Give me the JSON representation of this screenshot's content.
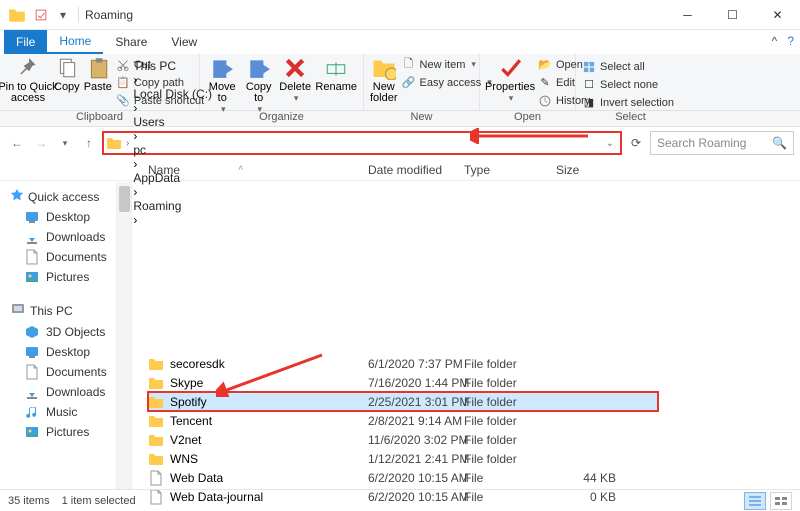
{
  "titlebar": {
    "title": "Roaming"
  },
  "tabs": {
    "file": "File",
    "home": "Home",
    "share": "Share",
    "view": "View"
  },
  "ribbon": {
    "clipboard": {
      "label": "Clipboard",
      "pin": "Pin to Quick\naccess",
      "copy": "Copy",
      "paste": "Paste",
      "cut": "Cut",
      "copypath": "Copy path",
      "pasteshortcut": "Paste shortcut"
    },
    "organize": {
      "label": "Organize",
      "moveto": "Move\nto",
      "copyto": "Copy\nto",
      "delete": "Delete",
      "rename": "Rename"
    },
    "new": {
      "label": "New",
      "newfolder": "New\nfolder",
      "newitem": "New item",
      "easyaccess": "Easy access"
    },
    "open": {
      "label": "Open",
      "properties": "Properties",
      "open": "Open",
      "edit": "Edit",
      "history": "History"
    },
    "select": {
      "label": "Select",
      "selectall": "Select all",
      "selectnone": "Select none",
      "invert": "Invert selection"
    }
  },
  "breadcrumbs": [
    "This PC",
    "Local Disk (C:)",
    "Users",
    "pc",
    "AppData",
    "Roaming"
  ],
  "search": {
    "placeholder": "Search Roaming"
  },
  "columns": {
    "name": "Name",
    "date": "Date modified",
    "type": "Type",
    "size": "Size"
  },
  "navpane": {
    "quick": {
      "label": "Quick access",
      "items": [
        "Desktop",
        "Downloads",
        "Documents",
        "Pictures"
      ]
    },
    "thispc": {
      "label": "This PC",
      "items": [
        "3D Objects",
        "Desktop",
        "Documents",
        "Downloads",
        "Music",
        "Pictures"
      ]
    }
  },
  "files": [
    {
      "name": "secoresdk",
      "date": "6/1/2020 7:37 PM",
      "type": "File folder",
      "size": "",
      "kind": "folder"
    },
    {
      "name": "Skype",
      "date": "7/16/2020 1:44 PM",
      "type": "File folder",
      "size": "",
      "kind": "folder"
    },
    {
      "name": "Spotify",
      "date": "2/25/2021 3:01 PM",
      "type": "File folder",
      "size": "",
      "kind": "folder",
      "selected": true
    },
    {
      "name": "Tencent",
      "date": "2/8/2021 9:14 AM",
      "type": "File folder",
      "size": "",
      "kind": "folder"
    },
    {
      "name": "V2net",
      "date": "11/6/2020 3:02 PM",
      "type": "File folder",
      "size": "",
      "kind": "folder"
    },
    {
      "name": "WNS",
      "date": "1/12/2021 2:41 PM",
      "type": "File folder",
      "size": "",
      "kind": "folder"
    },
    {
      "name": "Web Data",
      "date": "6/2/2020 10:15 AM",
      "type": "File",
      "size": "44 KB",
      "kind": "file"
    },
    {
      "name": "Web Data-journal",
      "date": "6/2/2020 10:15 AM",
      "type": "File",
      "size": "0 KB",
      "kind": "file"
    }
  ],
  "status": {
    "count": "35 items",
    "selected": "1 item selected"
  }
}
